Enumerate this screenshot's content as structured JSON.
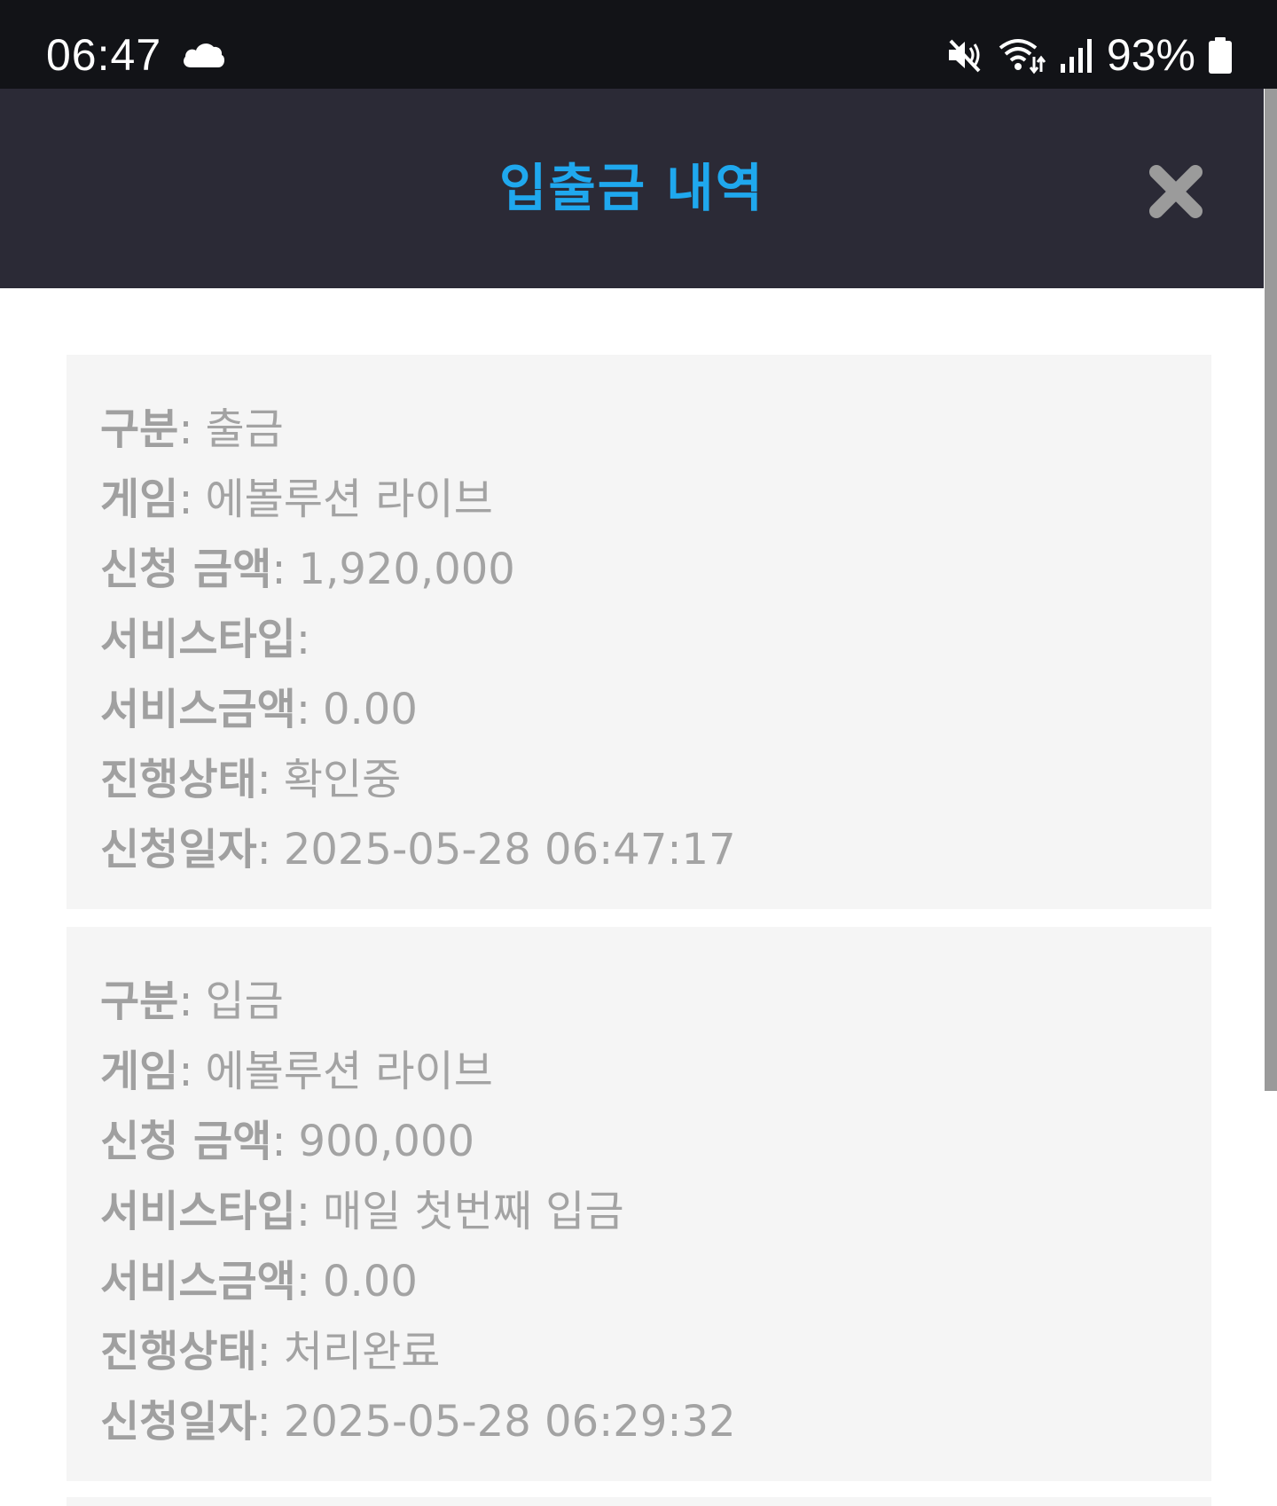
{
  "status_bar": {
    "time": "06:47",
    "battery": "93%",
    "icons": [
      "cloud-icon",
      "mute-icon",
      "wifi-icon",
      "signal-icon",
      "battery-icon"
    ]
  },
  "header": {
    "title": "입출금 내역",
    "close_icon": "close-icon",
    "title_color": "#1fa8ee",
    "background_color": "#2b2a36"
  },
  "records": [
    {
      "type_label": "구분",
      "type_value": "출금",
      "game_label": "게임",
      "game_value": "에볼루션 라이브",
      "amount_label": "신청 금액",
      "amount_value": "1,920,000",
      "service_type_label": "서비스타입",
      "service_type_value": "",
      "service_amount_label": "서비스금액",
      "service_amount_value": "0.00",
      "status_label": "진행상태",
      "status_value": "확인중",
      "date_label": "신청일자",
      "date_value": "2025-05-28 06:47:17"
    },
    {
      "type_label": "구분",
      "type_value": "입금",
      "game_label": "게임",
      "game_value": "에볼루션 라이브",
      "amount_label": "신청 금액",
      "amount_value": "900,000",
      "service_type_label": "서비스타입",
      "service_type_value": "매일 첫번째 입금",
      "service_amount_label": "서비스금액",
      "service_amount_value": "0.00",
      "status_label": "진행상태",
      "status_value": "처리완료",
      "date_label": "신청일자",
      "date_value": "2025-05-28 06:29:32"
    }
  ]
}
